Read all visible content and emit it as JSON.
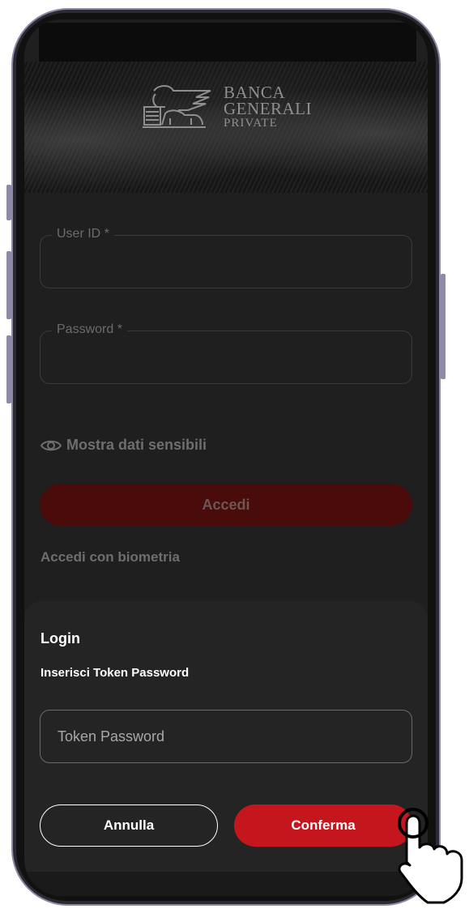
{
  "brand": {
    "line1": "BANCA",
    "line2": "GENERALI",
    "line3": "PRIVATE"
  },
  "login_form": {
    "user_id_label": "User ID *",
    "password_label": "Password *",
    "show_sensitive_label": "Mostra dati sensibili",
    "submit_label": "Accedi",
    "biometric_link": "Accedi con biometria"
  },
  "token_sheet": {
    "title": "Login",
    "subtitle": "Inserisci Token Password",
    "token_placeholder": "Token Password",
    "cancel_label": "Annulla",
    "confirm_label": "Conferma"
  },
  "icons": {
    "logo": "lion-logo-icon",
    "eye": "eye-icon",
    "cursor": "hand-pointer-icon"
  },
  "colors": {
    "background": "#1f1f1f",
    "sheet": "#242424",
    "accent": "#c4161c",
    "accent_dim": "#4a0b0b"
  }
}
